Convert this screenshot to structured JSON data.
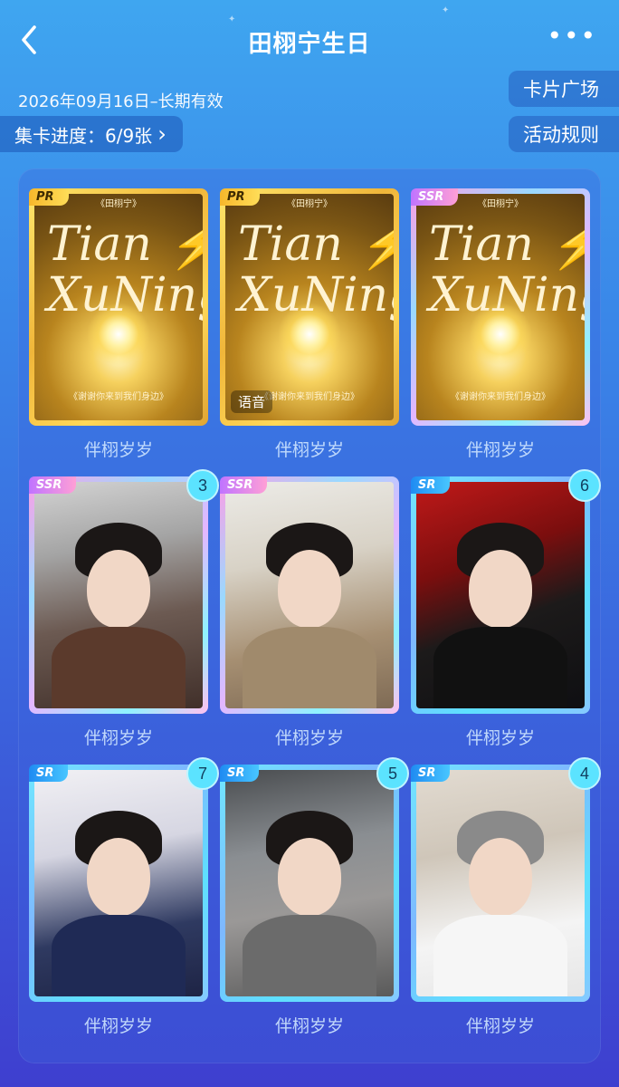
{
  "header": {
    "title": "田栩宁生日",
    "more": "•••",
    "date": "2026年09月16日–长期有效",
    "progress_label": "集卡进度：6/9张",
    "progress_arrow": "›",
    "card_plaza": "卡片广场",
    "rules": "活动规则"
  },
  "cards": [
    {
      "rarity": "PR",
      "name": "伴栩岁岁",
      "count": "",
      "voice": "",
      "art": {
        "title1": "Tian ⚡",
        "title2": "XuNing",
        "top": "《田栩宁》",
        "sub": "《谢谢你来到我们身边》"
      }
    },
    {
      "rarity": "PR",
      "name": "伴栩岁岁",
      "count": "",
      "voice": "语音",
      "art": {
        "title1": "Tian ⚡",
        "title2": "XuNing",
        "top": "《田栩宁》",
        "sub": "《谢谢你来到我们身边》"
      }
    },
    {
      "rarity": "SSR",
      "name": "伴栩岁岁",
      "count": "",
      "voice": "",
      "art": {
        "title1": "Tian ⚡",
        "title2": "XuNing",
        "top": "《田栩宁》",
        "sub": "《谢谢你来到我们身边》"
      }
    },
    {
      "rarity": "SSR",
      "name": "伴栩岁岁",
      "count": "3",
      "voice": ""
    },
    {
      "rarity": "SSR",
      "name": "伴栩岁岁",
      "count": "",
      "voice": ""
    },
    {
      "rarity": "SR",
      "name": "伴栩岁岁",
      "count": "6",
      "voice": ""
    },
    {
      "rarity": "SR",
      "name": "伴栩岁岁",
      "count": "7",
      "voice": ""
    },
    {
      "rarity": "SR",
      "name": "伴栩岁岁",
      "count": "5",
      "voice": ""
    },
    {
      "rarity": "SR",
      "name": "伴栩岁岁",
      "count": "4",
      "voice": ""
    }
  ],
  "icons": {
    "back": "back-arrow-icon",
    "more": "more-dots-icon"
  },
  "colors": {
    "accent": "#5be3ff",
    "pr": "#f7b72b",
    "ssr": "#c074ff",
    "sr": "#1f8bf2"
  }
}
